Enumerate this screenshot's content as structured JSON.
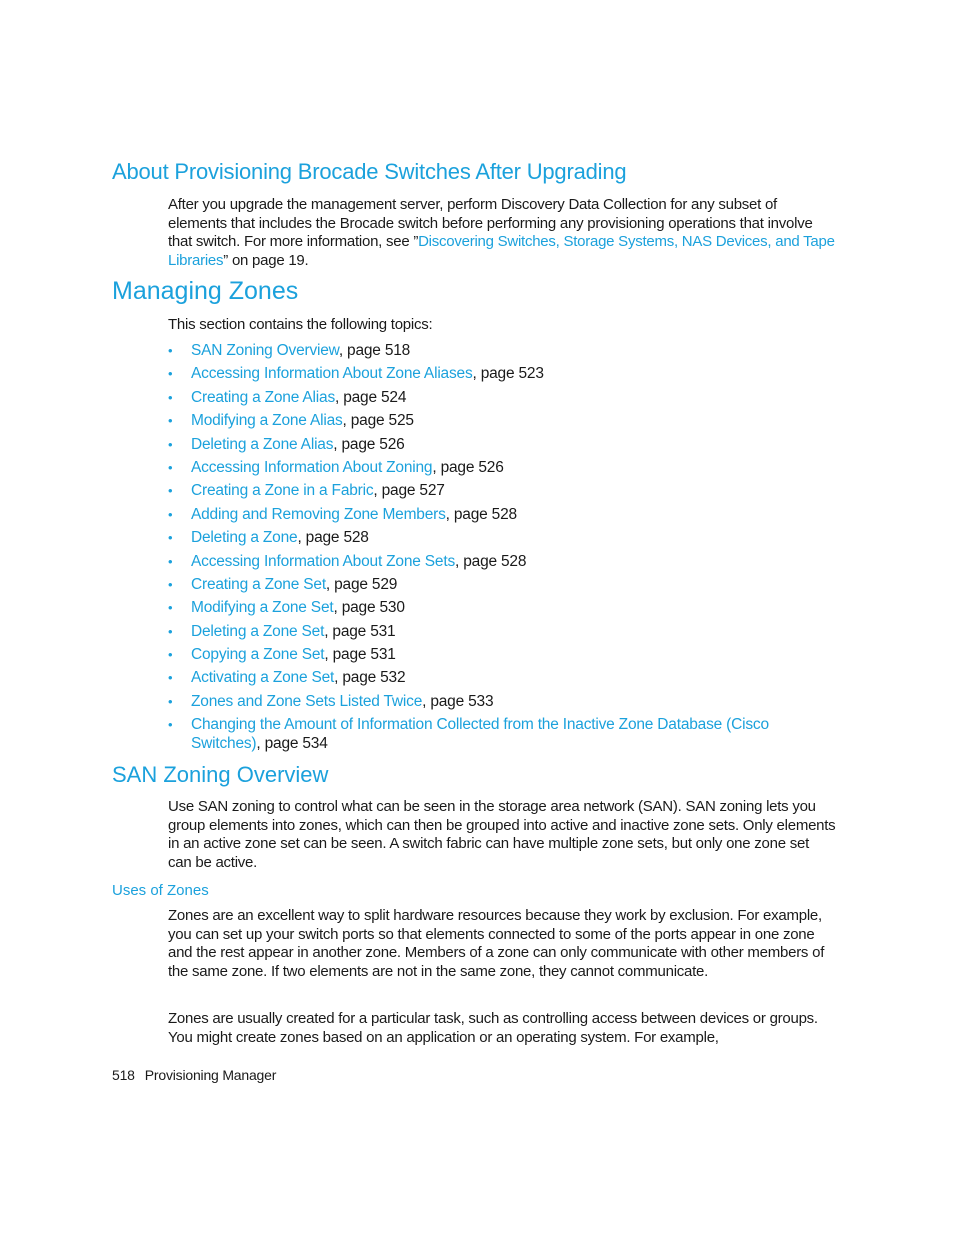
{
  "sections": {
    "about": {
      "heading": "About Provisioning Brocade Switches After Upgrading",
      "text_before": "After you upgrade the management server, perform Discovery Data Collection for any subset of elements that includes the Brocade switch before performing any provisioning operations that involve that switch. For more information, see ”",
      "link": "Discovering Switches, Storage Systems, NAS Devices, and Tape Libraries",
      "text_after": "” on page 19."
    },
    "managing": {
      "heading": "Managing Zones",
      "intro": "This section contains the following topics:",
      "bullet": "•",
      "topics": [
        {
          "title": "SAN Zoning Overview",
          "suffix": ", page 518"
        },
        {
          "title": "Accessing Information About Zone Aliases",
          "suffix": ", page 523"
        },
        {
          "title": "Creating a Zone Alias",
          "suffix": ", page 524"
        },
        {
          "title": "Modifying a Zone Alias",
          "suffix": ", page 525"
        },
        {
          "title": "Deleting a Zone Alias",
          "suffix": ", page 526"
        },
        {
          "title": "Accessing Information About Zoning",
          "suffix": ", page 526"
        },
        {
          "title": "Creating a Zone in a Fabric",
          "suffix": ", page 527"
        },
        {
          "title": "Adding and Removing Zone Members",
          "suffix": ", page 528"
        },
        {
          "title": "Deleting a Zone",
          "suffix": ", page 528"
        },
        {
          "title": "Accessing Information About Zone Sets",
          "suffix": ", page 528"
        },
        {
          "title": "Creating a Zone Set",
          "suffix": ", page 529"
        },
        {
          "title": "Modifying a Zone Set",
          "suffix": ", page 530"
        },
        {
          "title": "Deleting a Zone Set",
          "suffix": ", page 531"
        },
        {
          "title": "Copying a Zone Set",
          "suffix": ", page 531"
        },
        {
          "title": "Activating a Zone Set",
          "suffix": ", page 532"
        },
        {
          "title": "Zones and Zone Sets Listed Twice",
          "suffix": ", page 533"
        },
        {
          "title": "Changing the Amount of Information Collected from the Inactive Zone Database (Cisco Switches)",
          "suffix": ", page 534"
        }
      ]
    },
    "san": {
      "heading": "SAN Zoning Overview",
      "text": "Use SAN zoning to control what can be seen in the storage area network (SAN). SAN zoning lets you group elements into zones, which can then be grouped into active and inactive zone sets. Only elements in an active zone set can be seen. A switch fabric can have multiple zone sets, but only one zone set can be active."
    },
    "uses": {
      "heading": "Uses of Zones",
      "para1": "Zones are an excellent way to split hardware resources because they work by exclusion. For example, you can set up your switch ports so that elements connected to some of the ports appear in one zone and the rest appear in another zone. Members of a zone can only communicate with other members of the same zone. If two elements are not in the same zone, they cannot communicate.",
      "para2": "Zones are usually created for a particular task, such as controlling access between devices or groups. You might create zones based on an application or an operating system. For example,"
    }
  },
  "footer": {
    "page_number": "518",
    "title": "Provisioning Manager"
  },
  "colors": {
    "accent": "#1ba1dc",
    "text": "#1a1a1a"
  }
}
